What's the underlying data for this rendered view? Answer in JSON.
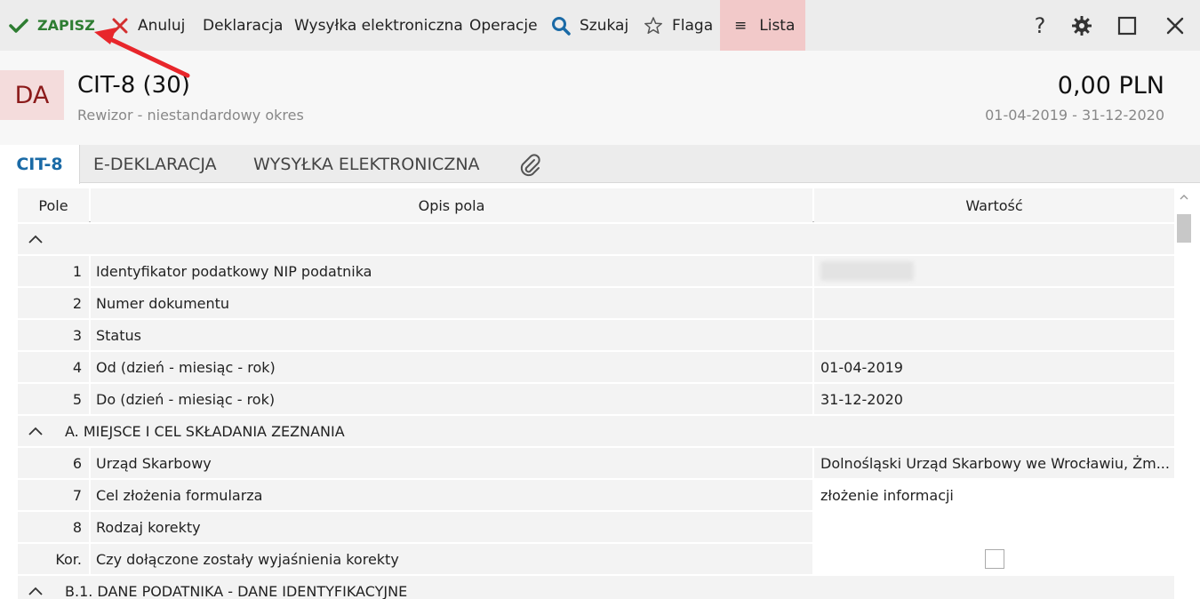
{
  "toolbar": {
    "save": "ZAPISZ",
    "cancel": "Anuluj",
    "declaration": "Deklaracja",
    "send": "Wysyłka elektroniczna",
    "operations": "Operacje",
    "search": "Szukaj",
    "flag": "Flaga",
    "list": "Lista",
    "help": "?"
  },
  "header": {
    "badge": "DA",
    "title": "CIT-8 (30)",
    "subtitle": "Rewizor - niestandardowy okres",
    "amount": "0,00 PLN",
    "period": "01-04-2019 - 31-12-2020"
  },
  "tabs": [
    "CIT-8",
    "E-DEKLARACJA",
    "WYSYŁKA ELEKTRONICZNA"
  ],
  "table": {
    "columns": [
      "Pole",
      "Opis pola",
      "Wartość"
    ],
    "rows": [
      {
        "num": "1",
        "desc": "Identyfikator podatkowy NIP podatnika",
        "value": ""
      },
      {
        "num": "2",
        "desc": "Numer dokumentu",
        "value": ""
      },
      {
        "num": "3",
        "desc": "Status",
        "value": ""
      },
      {
        "num": "4",
        "desc": "Od (dzień - miesiąc - rok)",
        "value": "01-04-2019"
      },
      {
        "num": "5",
        "desc": "Do (dzień - miesiąc - rok)",
        "value": "31-12-2020"
      },
      {
        "num": "6",
        "desc": "Urząd Skarbowy",
        "value": "Dolnośląski Urząd Skarbowy we Wrocławiu, Żm..."
      },
      {
        "num": "7",
        "desc": "Cel złożenia formularza",
        "value": "złożenie informacji"
      },
      {
        "num": "8",
        "desc": "Rodzaj korekty",
        "value": ""
      },
      {
        "num": "Kor.",
        "desc": "Czy dołączone zostały wyjaśnienia korekty",
        "value": ""
      }
    ],
    "sections": [
      "",
      "A. MIEJSCE I CEL SKŁADANIA ZEZNANIA",
      "B.1. DANE PODATNIKA - DANE IDENTYFIKACYJNE"
    ]
  },
  "colors": {
    "save_green": "#2e7d32",
    "cancel_red": "#d32f2f",
    "search_blue": "#1a6aa6",
    "list_bg": "#f2c9c9",
    "badge_bg": "#f4dcdc",
    "badge_text": "#8b1a1a",
    "active_tab": "#1a6aa6",
    "arrow_red": "#e8262b"
  },
  "icons": [
    "check-icon",
    "cross-icon",
    "search-icon",
    "star-icon",
    "hamburger-icon",
    "help-icon",
    "gear-icon",
    "maximize-icon",
    "close-icon",
    "paperclip-icon",
    "chevron-up-icon",
    "checkbox"
  ]
}
